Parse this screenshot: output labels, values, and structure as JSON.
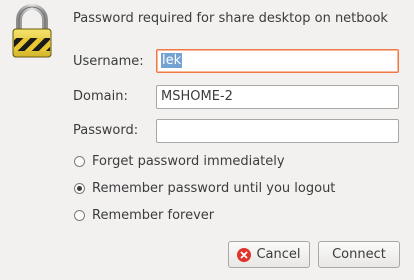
{
  "dialog": {
    "message": "Password required for share desktop on netbook",
    "lock_icon": "padlock-icon"
  },
  "form": {
    "username_label": "Username:",
    "username_value": "lek",
    "domain_label": "Domain:",
    "domain_value": "MSHOME-2",
    "password_label": "Password:",
    "password_value": ""
  },
  "options": [
    {
      "label": "Forget password immediately",
      "checked": false
    },
    {
      "label": "Remember password until you logout",
      "checked": true
    },
    {
      "label": "Remember forever",
      "checked": false
    }
  ],
  "buttons": {
    "cancel_label": "Cancel",
    "cancel_icon": "cancel-icon",
    "connect_label": "Connect"
  },
  "colors": {
    "focus_border": "#f07746",
    "selection": "#74a2d3",
    "cancel_icon": "#e0332b"
  }
}
